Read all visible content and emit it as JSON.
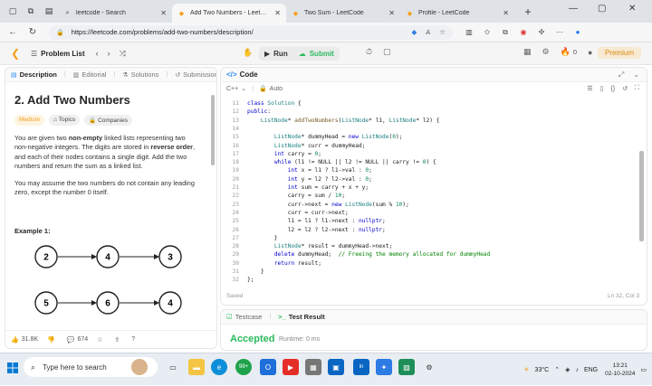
{
  "browser": {
    "tabs": [
      {
        "title": "leetcode - Search",
        "icon": "search-icon",
        "active": false
      },
      {
        "title": "Add Two Numbers - LeetCode",
        "icon": "leetcode-icon",
        "active": true
      },
      {
        "title": "Two Sum - LeetCode",
        "icon": "leetcode-icon",
        "active": false
      },
      {
        "title": "Profile - LeetCode",
        "icon": "leetcode-icon",
        "active": false
      }
    ],
    "url": "https://leetcode.com/problems/add-two-numbers/description/"
  },
  "lcbar": {
    "problem_list": "Problem List",
    "run": "Run",
    "submit": "Submit",
    "count": "0",
    "premium": "Premium"
  },
  "left": {
    "tabs": {
      "description": "Description",
      "editorial": "Editorial",
      "solutions": "Solutions",
      "submissions": "Submissions"
    },
    "title": "2. Add Two Numbers",
    "difficulty": "Medium",
    "topics": "Topics",
    "companies": "Companies",
    "p1": {
      "a": "You are given two ",
      "b": "non-empty",
      "c": " linked lists representing two non-negative integers. The digits are stored in ",
      "d": "reverse order",
      "e": ", and each of their nodes contains a single digit. Add the two numbers and return the sum as a linked list."
    },
    "p2": "You may assume the two numbers do not contain any leading zero, except the number 0 itself.",
    "example": "Example 1:",
    "diagram": {
      "row1": [
        "2",
        "4",
        "3"
      ],
      "row2": [
        "5",
        "6",
        "4"
      ]
    },
    "footer": {
      "likes": "31.8K",
      "comments": "674"
    }
  },
  "code": {
    "header": "Code",
    "lang": "C++",
    "mode": "Auto",
    "status": "Saved",
    "position": "Ln 32, Col 3",
    "line_numbers": [
      "11",
      "12",
      "13",
      "14",
      "15",
      "16",
      "17",
      "18",
      "19",
      "20",
      "21",
      "22",
      "23",
      "24",
      "25",
      "26",
      "27",
      "28",
      "29",
      "30",
      "31",
      "32"
    ]
  },
  "result": {
    "testcase": "Testcase",
    "test_result": "Test Result",
    "verdict": "Accepted",
    "runtime": "Runtime: 0 ms"
  },
  "taskbar": {
    "search": "Type here to search",
    "weather": "33°C",
    "lang": "ENG",
    "time": "13:21",
    "date": "02-10-2024"
  }
}
